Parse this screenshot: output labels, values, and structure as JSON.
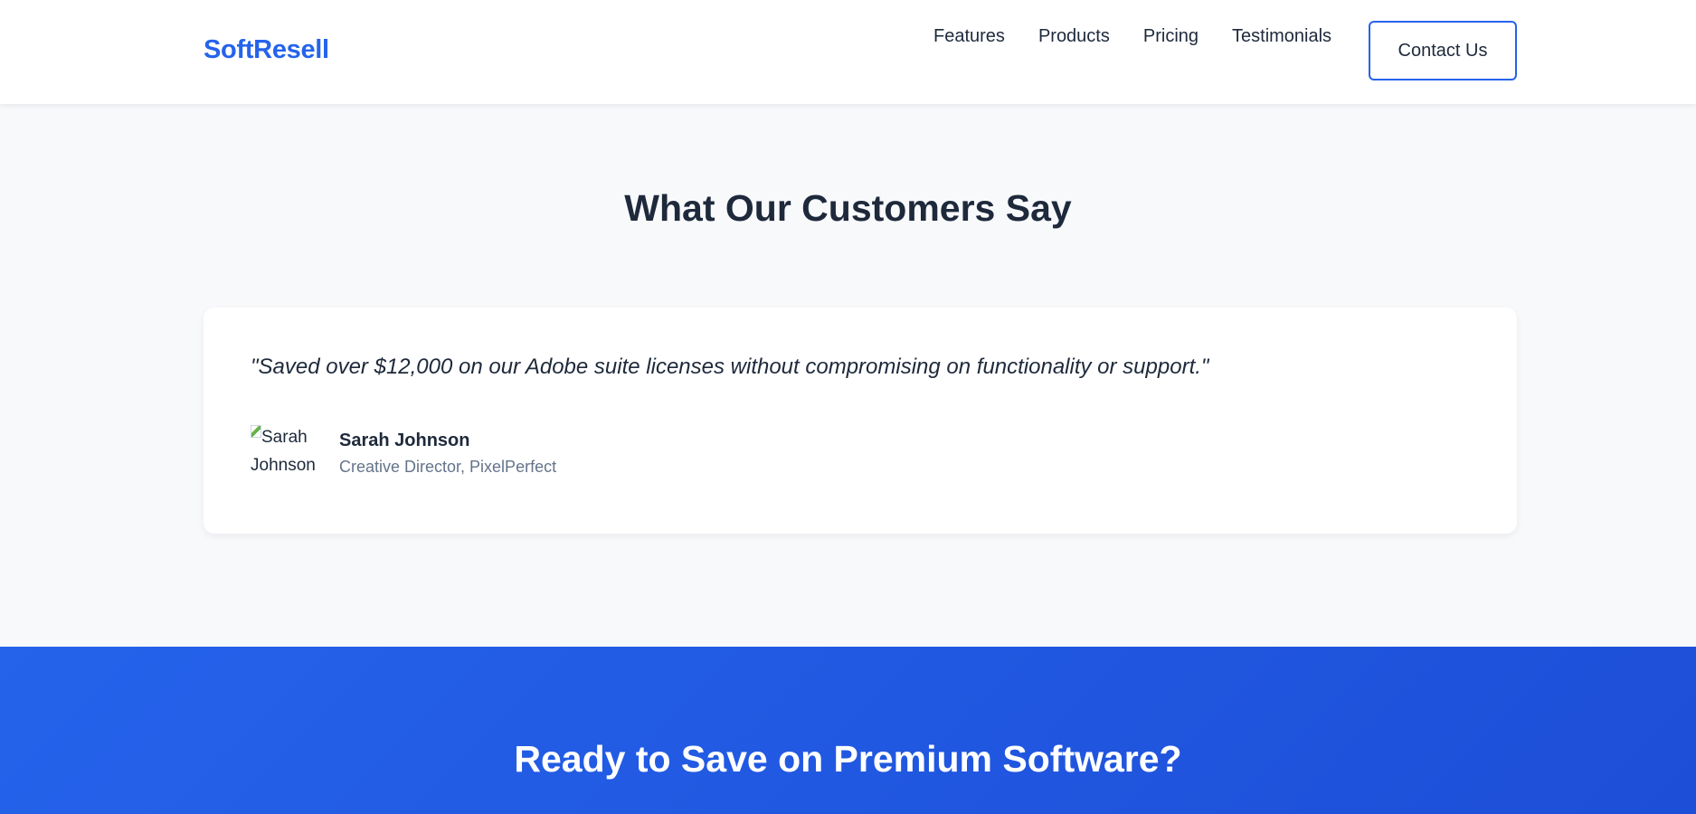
{
  "header": {
    "logo": "SoftResell",
    "nav": [
      "Features",
      "Products",
      "Pricing",
      "Testimonials"
    ],
    "contact_label": "Contact Us"
  },
  "testimonials": {
    "title": "What Our Customers Say",
    "items": [
      {
        "quote": "\"Saved over $12,000 on our Adobe suite licenses without compromising on functionality or support.\"",
        "avatar_alt": "Sarah Johnson",
        "name": "Sarah Johnson",
        "role": "Creative Director, PixelPerfect"
      }
    ]
  },
  "cta": {
    "title": "Ready to Save on Premium Software?"
  },
  "colors": {
    "accent": "#2563eb",
    "text": "#1e293b",
    "muted": "#64748b",
    "section_bg": "#f8f9fb"
  }
}
